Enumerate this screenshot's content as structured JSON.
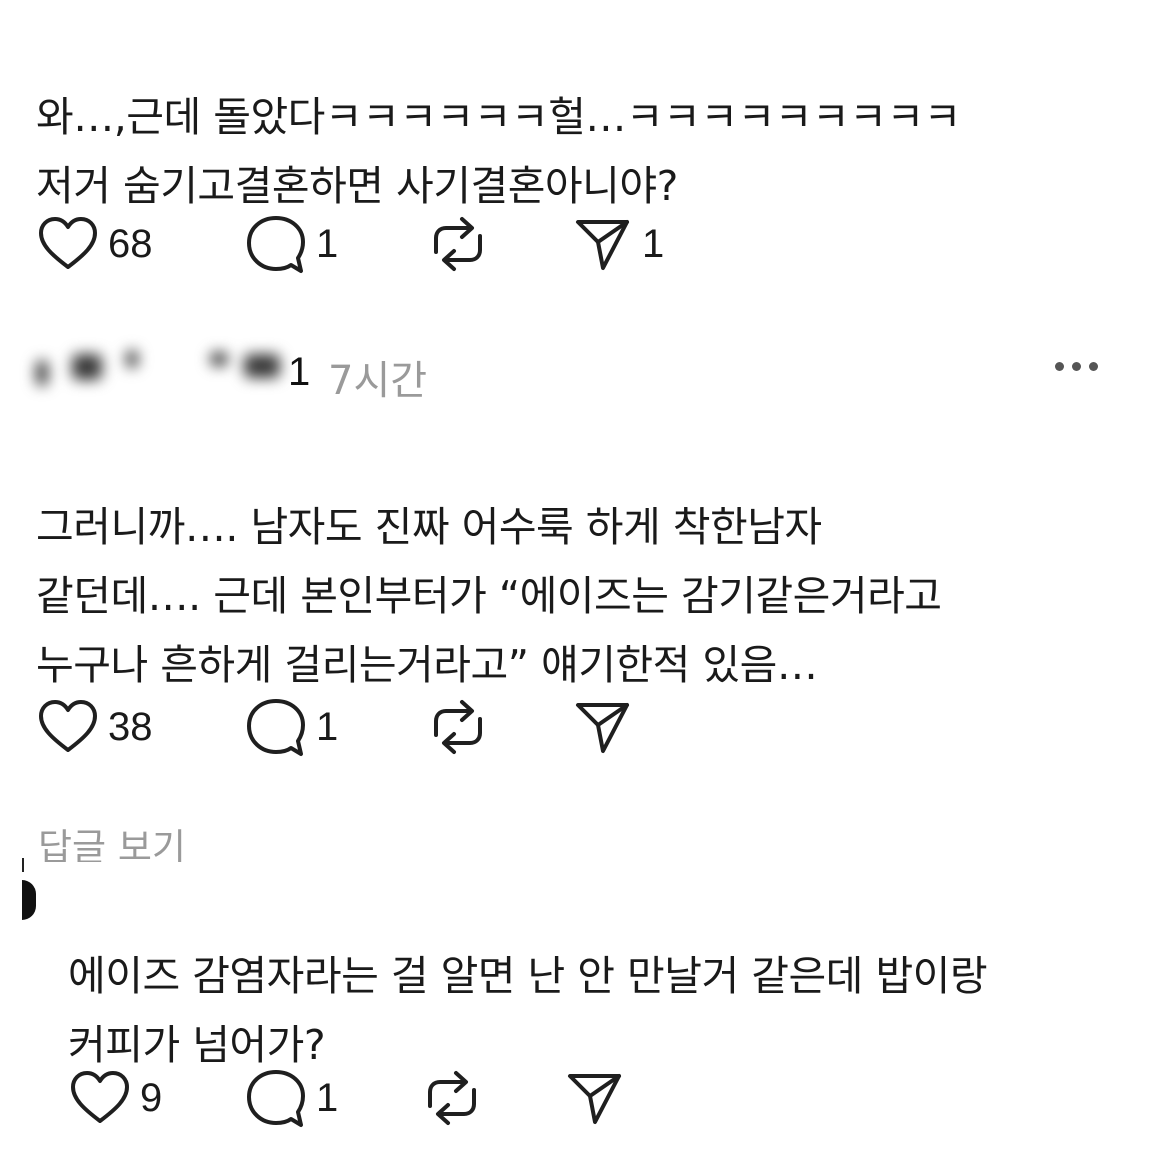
{
  "posts": [
    {
      "lines": [
        "와…,근데 돌았다ㅋㅋㅋㅋㅋㅋ헐…ㅋㅋㅋㅋㅋㅋㅋㅋㅋ",
        "저거 숨기고결혼하면 사기결혼아니야?"
      ],
      "like_count": "68",
      "reply_count": "1",
      "share_count": "1"
    },
    {
      "username_tail": "1",
      "timestamp": "7시간",
      "lines": [
        "그러니까…. 남자도 진짜 어수룩 하게 착한남자",
        "같던데…. 근데 본인부터가 “에이즈는 감기같은거라고",
        "누구나 흔하게 걸리는거라고” 얘기한적 있음…"
      ],
      "like_count": "38",
      "reply_count": "1"
    },
    {
      "view_replies_label": "답글 보기",
      "lines": [
        "에이즈 감염자라는 걸 알면 난 안 만날거 같은데 밥이랑",
        "커피가 넘어가?"
      ],
      "like_count": "9",
      "reply_count": "1"
    }
  ],
  "icons": {
    "like": "heart-icon",
    "reply": "comment-icon",
    "repost": "repost-icon",
    "share": "send-icon"
  },
  "colors": {
    "text": "#1a1a1a",
    "secondary": "#9a9a9a",
    "icon": "#1f1f1f"
  }
}
